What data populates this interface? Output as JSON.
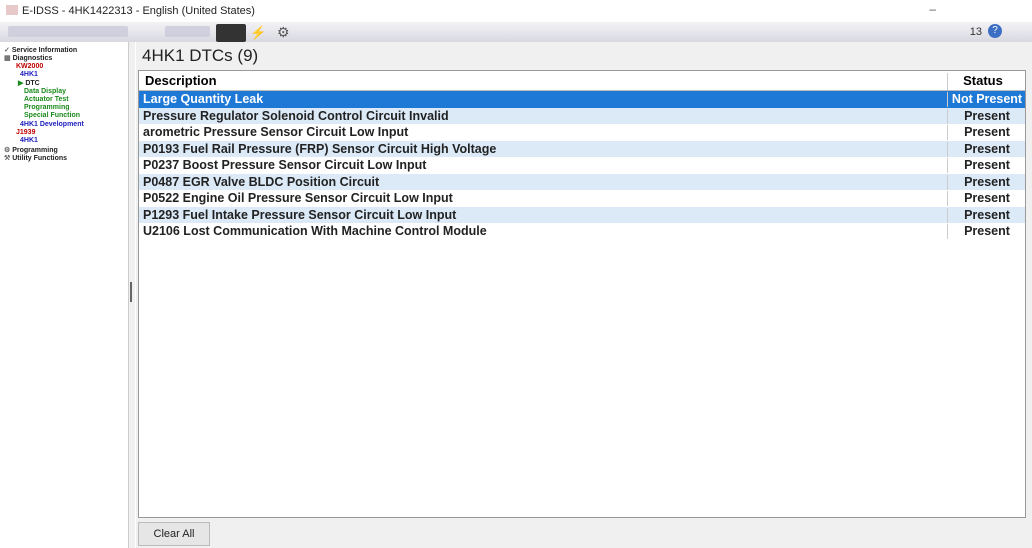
{
  "window": {
    "title": "E-IDSS - 4HK1422313 - English (United States)",
    "minimize": "–"
  },
  "toolbar": {
    "id_text": "13",
    "help": "?"
  },
  "sidebar": {
    "items": [
      {
        "label": "Service Information",
        "color": "#222"
      },
      {
        "label": "Diagnostics",
        "color": "#222"
      },
      {
        "label": "KW2000",
        "color": "#c00000"
      },
      {
        "label": "4HK1",
        "color": "#2020c0"
      },
      {
        "label": "DTC",
        "color": "#222"
      },
      {
        "label": "Data Display",
        "color": "#1a8a1a"
      },
      {
        "label": "Actuator Test",
        "color": "#1a8a1a"
      },
      {
        "label": "Programming",
        "color": "#1a8a1a"
      },
      {
        "label": "Special Function",
        "color": "#1a8a1a"
      },
      {
        "label": "4HK1 Development",
        "color": "#2020c0"
      },
      {
        "label": "J1939",
        "color": "#c00000"
      },
      {
        "label": "4HK1",
        "color": "#2020c0"
      },
      {
        "label": "Programming",
        "color": "#222"
      },
      {
        "label": "Utility Functions",
        "color": "#222"
      }
    ]
  },
  "main": {
    "title": "4HK1 DTCs  (9)",
    "columns": {
      "description": "Description",
      "status": "Status"
    },
    "rows": [
      {
        "description": "Large Quantity Leak",
        "status": "Not Present"
      },
      {
        "description": "Pressure Regulator Solenoid Control Circuit Invalid",
        "status": "Present"
      },
      {
        "description": "arometric Pressure Sensor Circuit Low Input",
        "status": "Present"
      },
      {
        "description": "P0193 Fuel Rail Pressure (FRP) Sensor Circuit High Voltage",
        "status": "Present"
      },
      {
        "description": "P0237 Boost Pressure Sensor Circuit Low Input",
        "status": "Present"
      },
      {
        "description": "P0487 EGR Valve BLDC Position Circuit",
        "status": "Present"
      },
      {
        "description": "P0522 Engine Oil Pressure Sensor Circuit Low Input",
        "status": "Present"
      },
      {
        "description": "P1293 Fuel Intake Pressure Sensor Circuit Low Input",
        "status": "Present"
      },
      {
        "description": "U2106 Lost Communication With Machine Control Module",
        "status": "Present"
      }
    ],
    "clear_all": "Clear All"
  }
}
